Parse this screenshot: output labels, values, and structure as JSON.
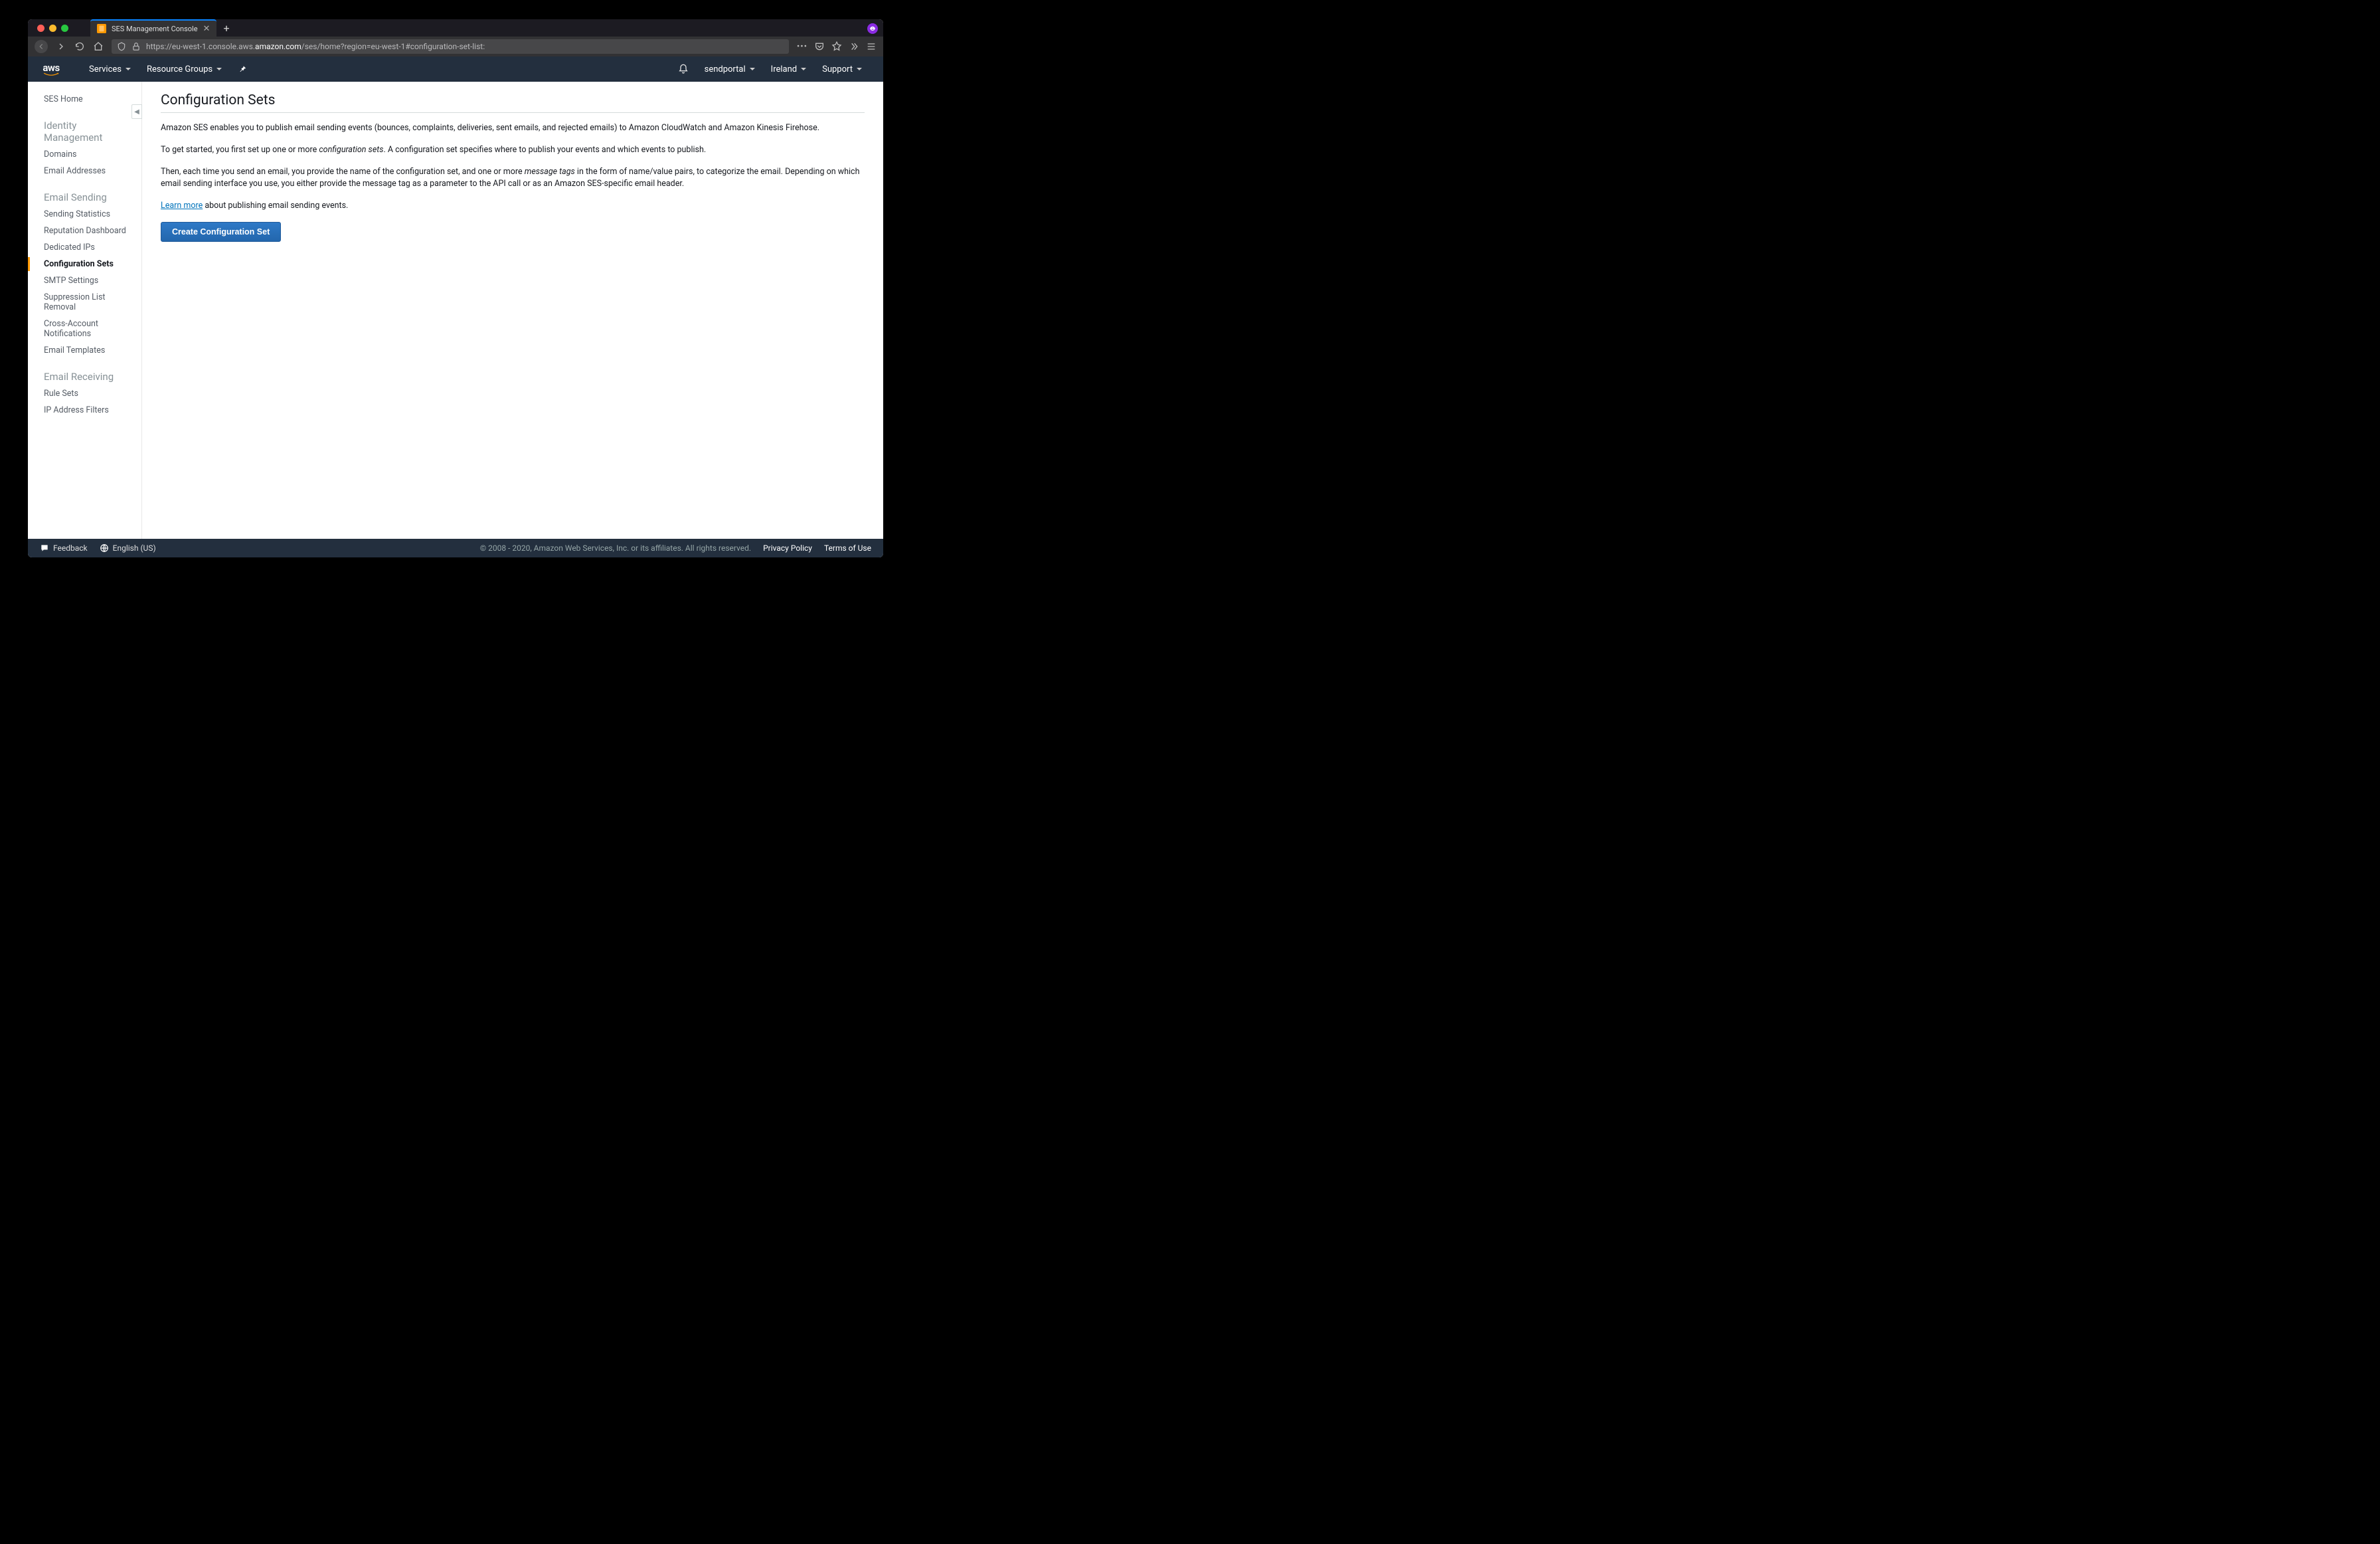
{
  "browser": {
    "tab_title": "SES Management Console",
    "url_prefix": "https://eu-west-1.console.aws.",
    "url_domain": "amazon.com",
    "url_path": "/ses/home?region=eu-west-1#configuration-set-list:"
  },
  "nav": {
    "services": "Services",
    "resource_groups": "Resource Groups",
    "account": "sendportal",
    "region": "Ireland",
    "support": "Support"
  },
  "sidebar": {
    "home": "SES Home",
    "group1_head": "Identity Management",
    "group1": [
      "Domains",
      "Email Addresses"
    ],
    "group2_head": "Email Sending",
    "group2": [
      "Sending Statistics",
      "Reputation Dashboard",
      "Dedicated IPs",
      "Configuration Sets",
      "SMTP Settings",
      "Suppression List Removal",
      "Cross-Account Notifications",
      "Email Templates"
    ],
    "group2_active_index": 3,
    "group3_head": "Email Receiving",
    "group3": [
      "Rule Sets",
      "IP Address Filters"
    ]
  },
  "main": {
    "title": "Configuration Sets",
    "p1": "Amazon SES enables you to publish email sending events (bounces, complaints, deliveries, sent emails, and rejected emails) to Amazon CloudWatch and Amazon Kinesis Firehose.",
    "p2a": "To get started, you first set up one or more ",
    "p2em": "configuration sets",
    "p2b": ". A configuration set specifies where to publish your events and which events to publish.",
    "p3a": "Then, each time you send an email, you provide the name of the configuration set, and one or more ",
    "p3em": "message tags",
    "p3b": " in the form of name/value pairs, to categorize the email. Depending on which email sending interface you use, you either provide the message tag as a parameter to the API call or as an Amazon SES-specific email header.",
    "learn_more": "Learn more",
    "learn_more_tail": " about publishing email sending events.",
    "button": "Create Configuration Set"
  },
  "footer": {
    "feedback": "Feedback",
    "language": "English (US)",
    "copyright": "© 2008 - 2020, Amazon Web Services, Inc. or its affiliates. All rights reserved.",
    "privacy": "Privacy Policy",
    "terms": "Terms of Use"
  }
}
